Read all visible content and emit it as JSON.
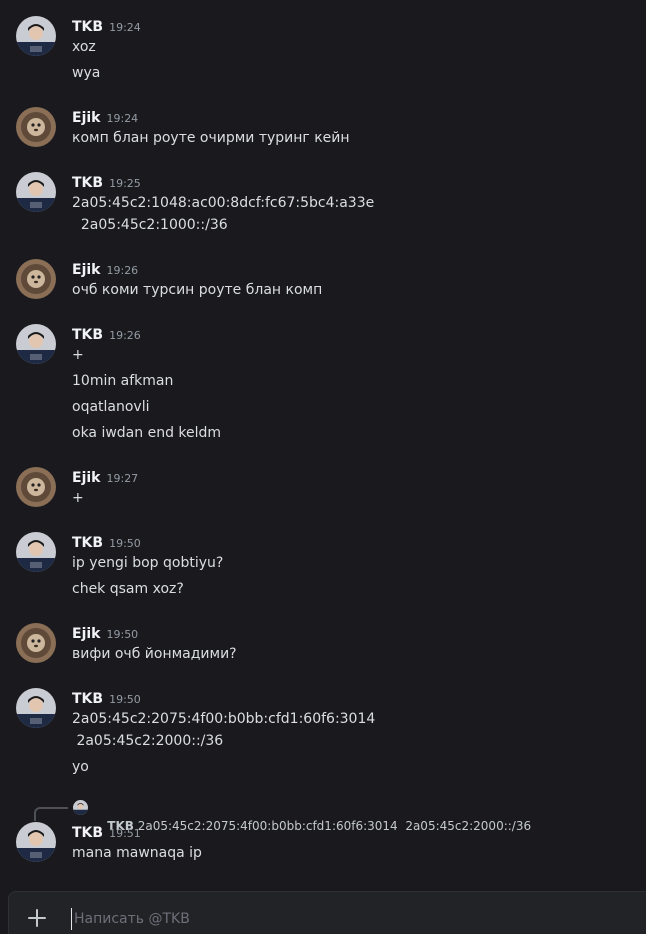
{
  "colors": {
    "background": "#1a1a1e",
    "author": "#f2f3f5",
    "text": "#dbdee1",
    "timestamp": "#949ba4",
    "composer_bg": "#222327"
  },
  "users": {
    "tkb": {
      "name": "TKB",
      "avatar_icon": "tkb-avatar-icon"
    },
    "ejik": {
      "name": "Ejik",
      "avatar_icon": "ejik-avatar-icon"
    }
  },
  "messages": [
    {
      "author": "TKB",
      "time": "19:24",
      "lines": [
        "xoz",
        "wya"
      ]
    },
    {
      "author": "Ejik",
      "time": "19:24",
      "lines": [
        "комп блан роуте очирми туринг кейн"
      ]
    },
    {
      "author": "TKB",
      "time": "19:25",
      "lines": [
        "2a05:45c2:1048:ac00:8dcf:fc67:5bc4:a33e",
        "  2a05:45c2:1000::/36"
      ]
    },
    {
      "author": "Ejik",
      "time": "19:26",
      "lines": [
        "очб коми турсин роуте блан комп"
      ]
    },
    {
      "author": "TKB",
      "time": "19:26",
      "lines": [
        "+",
        "10min afkman",
        "oqatlanovli",
        "oka iwdan end keldm"
      ]
    },
    {
      "author": "Ejik",
      "time": "19:27",
      "lines": [
        "+"
      ]
    },
    {
      "author": "TKB",
      "time": "19:50",
      "lines": [
        "ip yengi bop qobtiyu?",
        "chek qsam xoz?"
      ]
    },
    {
      "author": "Ejik",
      "time": "19:50",
      "lines": [
        "вифи очб йонмадими?"
      ]
    },
    {
      "author": "TKB",
      "time": "19:50",
      "lines": [
        "2a05:45c2:2075:4f00:b0bb:cfd1:60f6:3014",
        " 2a05:45c2:2000::/36",
        "yo"
      ]
    },
    {
      "author": "TKB",
      "time": "19:51",
      "lines": [
        "mana mawnaqa ip"
      ]
    }
  ],
  "reply": {
    "author": "TKB",
    "content": "2a05:45c2:2075:4f00:b0bb:cfd1:60f6:3014  2a05:45c2:2000::/36"
  },
  "composer": {
    "placeholder": "Написать @TKB",
    "value": "",
    "add_icon": "plus-icon"
  }
}
